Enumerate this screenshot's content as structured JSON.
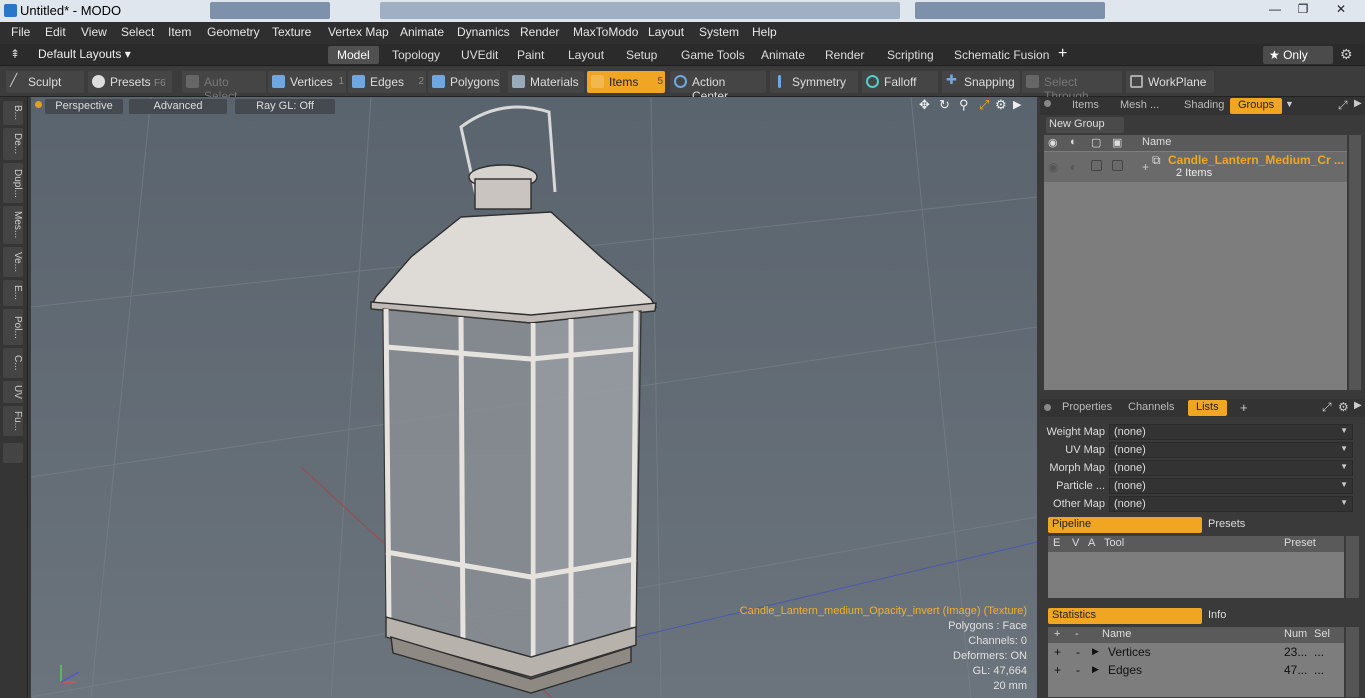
{
  "titlebar": {
    "title": "Untitled* - MODO",
    "minimize": "—",
    "maximize": "❐",
    "close": "✕"
  },
  "menubar": [
    "File",
    "Edit",
    "View",
    "Select",
    "Item",
    "Geometry",
    "Texture",
    "Vertex Map",
    "Animate",
    "Dynamics",
    "Render",
    "MaxToModo",
    "Layout",
    "System",
    "Help"
  ],
  "layoutbar": {
    "layouts_label": "Default Layouts ▾",
    "tabs": [
      "Model",
      "Topology",
      "UVEdit",
      "Paint",
      "Layout",
      "Setup",
      "Game Tools",
      "Animate",
      "Render",
      "Scripting",
      "Schematic Fusion"
    ],
    "active": "Model",
    "plus": "+",
    "only": "★ Only"
  },
  "toolbar": {
    "sculpt": "Sculpt",
    "presets": "Presets",
    "presets_key": "F6",
    "auto_select": "Auto Select",
    "vertices": "Vertices",
    "vertices_num": "1",
    "edges": "Edges",
    "edges_num": "2",
    "polygons": "Polygons",
    "materials": "Materials",
    "items": "Items",
    "items_num": "5",
    "action_center": "Action Center",
    "symmetry": "Symmetry",
    "falloff": "Falloff",
    "snapping": "Snapping",
    "select_through": "Select Through",
    "workplane": "WorkPlane"
  },
  "leftstrip": [
    "B...",
    "De...",
    "Dupl...",
    "Mes...",
    "Ve...",
    "E...",
    "Pol...",
    "C...",
    "UV",
    "Fu..."
  ],
  "viewport": {
    "perspective": "Perspective",
    "advanced": "Advanced",
    "raygl": "Ray GL: Off",
    "info": {
      "texture": "Candle_Lantern_medium_Opacity_invert (Image) (Texture)",
      "polygons": "Polygons : Face",
      "channels": "Channels: 0",
      "deformers": "Deformers: ON",
      "gl": "GL: 47,664",
      "size": "20 mm"
    },
    "colors": {
      "texture_text": "#f0b030",
      "bg": "#5c6670"
    }
  },
  "top_panel": {
    "tabs": [
      "Items",
      "Mesh ...",
      "Shading",
      "Groups"
    ],
    "active": "Groups",
    "new_group": "New Group",
    "col_name": "Name",
    "group_name": "Candle_Lantern_Medium_Cr ...",
    "group_count": "2 Items"
  },
  "bottom_panel": {
    "tabs": [
      "Properties",
      "Channels",
      "Lists"
    ],
    "active": "Lists",
    "plus": "+",
    "maps": [
      {
        "label": "Weight Map",
        "value": "(none)"
      },
      {
        "label": "UV Map",
        "value": "(none)"
      },
      {
        "label": "Morph Map",
        "value": "(none)"
      },
      {
        "label": "Particle  ...",
        "value": "(none)"
      },
      {
        "label": "Other Map",
        "value": "(none)"
      }
    ],
    "pipeline": "Pipeline",
    "presets": "Presets",
    "pipe_cols": [
      "E",
      "V",
      "A",
      "Tool",
      "Preset"
    ],
    "statistics": "Statistics",
    "info": "Info",
    "stat_cols": [
      "+",
      "-",
      "Name",
      "Num",
      "Sel"
    ],
    "stats": [
      {
        "plus": "+",
        "minus": "-",
        "name": "Vertices",
        "num": "23...",
        "sel": "..."
      },
      {
        "plus": "+",
        "minus": "-",
        "name": "Edges",
        "num": "47...",
        "sel": "..."
      }
    ]
  }
}
